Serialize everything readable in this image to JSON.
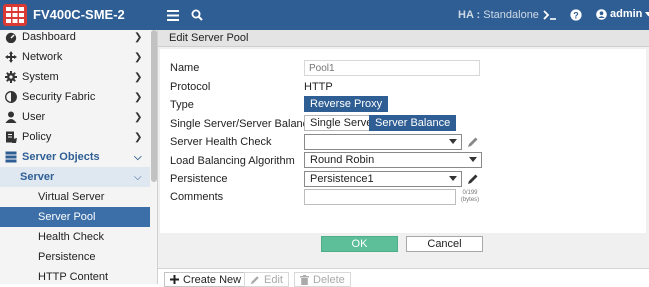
{
  "header": {
    "device_name": "FV400C-SME-2",
    "ha_label": "HA :",
    "ha_value": "Standalone",
    "user": "admin"
  },
  "sidebar": {
    "items": [
      {
        "label": "Dashboard",
        "icon": "dashboard-icon"
      },
      {
        "label": "Network",
        "icon": "network-icon"
      },
      {
        "label": "System",
        "icon": "gear-icon"
      },
      {
        "label": "Security Fabric",
        "icon": "security-fabric-icon"
      },
      {
        "label": "User",
        "icon": "user-icon"
      },
      {
        "label": "Policy",
        "icon": "policy-icon"
      },
      {
        "label": "Server Objects",
        "icon": "server-icon"
      }
    ],
    "sub_section": "Server",
    "sub_items": [
      "Virtual Server",
      "Server Pool",
      "Health Check",
      "Persistence",
      "HTTP Content"
    ]
  },
  "panel": {
    "title": "Edit Server Pool"
  },
  "form": {
    "name_label": "Name",
    "name_placeholder": "Pool1",
    "protocol_label": "Protocol",
    "protocol_value": "HTTP",
    "type_label": "Type",
    "type_value": "Reverse Proxy",
    "balance_label": "Single Server/Server Balance",
    "balance_options": [
      "Single Server",
      "Server Balance"
    ],
    "balance_selected": "Server Balance",
    "health_label": "Server Health Check",
    "health_value": "",
    "algo_label": "Load Balancing Algorithm",
    "algo_value": "Round Robin",
    "persistence_label": "Persistence",
    "persistence_value": "Persistence1",
    "comments_label": "Comments",
    "comments_counter": "0/199",
    "comments_unit": "(bytes)"
  },
  "buttons": {
    "ok": "OK",
    "cancel": "Cancel"
  },
  "listbar": {
    "create": "Create New",
    "edit": "Edit",
    "delete": "Delete"
  },
  "colors": {
    "header_bg": "#2e5e94",
    "active_nav": "#3c6fa8",
    "ok_button": "#5dbf99",
    "logo_red": "#d93a34"
  }
}
